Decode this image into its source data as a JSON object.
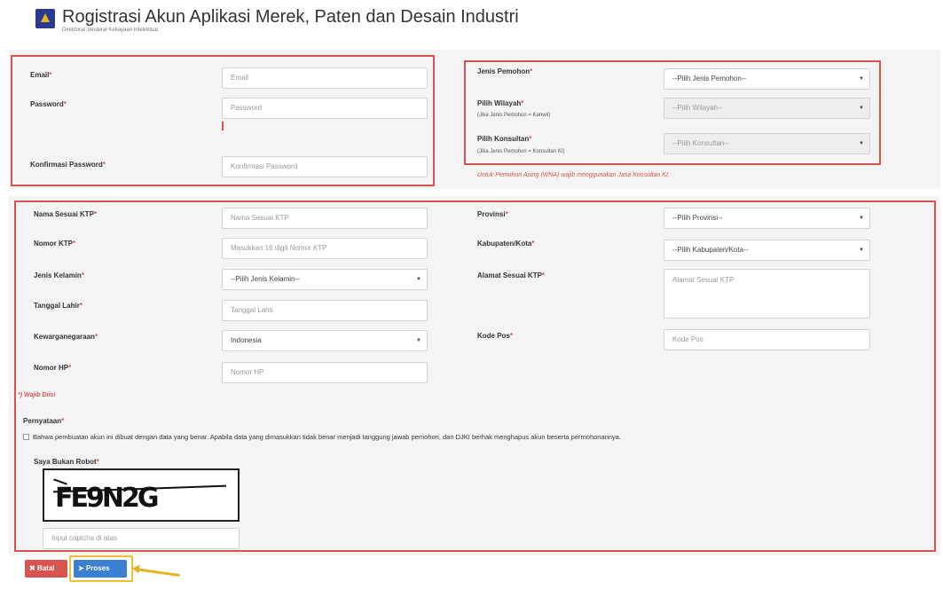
{
  "header": {
    "title": "Rogistrasi Akun Aplikasi Merek, Paten dan Desain Industri",
    "subtitle": "Direktorat Jenderal Kekayaan Intelektual"
  },
  "required_mark": "*",
  "account": {
    "email_label": "Email",
    "email_placeholder": "Email",
    "password_label": "Password",
    "password_placeholder": "Password",
    "confirm_label": "Konfirmasi Password",
    "confirm_placeholder": "Konfirmasi Password"
  },
  "applicant": {
    "jenis_label": "Jenis Pemohon",
    "jenis_value": "--Pilih Jenis Pemohon--",
    "wilayah_label": "Pilih Wilayah",
    "wilayah_hint": "(Jika Jenis Pemohon = Kanwil)",
    "wilayah_value": "--Pilih Wilayah--",
    "konsultan_label": "Pilih Konsultan",
    "konsultan_hint": "(Jika Jenis Pemohon = Konsultan KI)",
    "konsultan_value": "--Pilih Konsultan--",
    "foreign_note": "Untuk Pemohon Asing (WNA) wajib menggunakan Jasa Konsultan KI."
  },
  "personal": {
    "nama_label": "Nama Sesuai KTP",
    "nama_placeholder": "Nama Sesuai KTP",
    "ktp_label": "Nomor KTP",
    "ktp_placeholder": "Masukkan 16 digit Nomor KTP",
    "gender_label": "Jenis Kelamin",
    "gender_value": "--Pilih Jenis Kelamin--",
    "dob_label": "Tanggal Lahir",
    "dob_placeholder": "Tanggal Lahir",
    "citizenship_label": "Kewarganegaraan",
    "citizenship_value": "Indonesia",
    "hp_label": "Nomor HP",
    "hp_placeholder": "Nomor HP",
    "provinsi_label": "Provinsi",
    "provinsi_value": "--Pilih Provinsi--",
    "kabupaten_label": "Kabupaten/Kota",
    "kabupaten_value": "--Pilih Kabupaten/Kota--",
    "alamat_label": "Alamat Sesuai KTP",
    "alamat_placeholder": "Alamat Sesuai KTP",
    "kodepos_label": "Kode Pos",
    "kodepos_placeholder": "Kode Pos",
    "required_note": "*) Wajib Diisi"
  },
  "statement": {
    "label": "Pernyataan",
    "text": "Bahwa pembuatan akun ini dibuat dengan data yang benar. Apabila data yang dimasukkan tidak benar menjadi tanggung jawab pemohon, dan DJKI berhak menghapus akun beserta permohonannya."
  },
  "captcha": {
    "label": "Saya Bukan Robot",
    "text": "FE9N2G",
    "placeholder": "Input captcha di atas"
  },
  "actions": {
    "batal_label": "Batal",
    "batal_icon": "✖",
    "proses_label": "Proses",
    "proses_icon": "➤"
  },
  "colors": {
    "highlight": "#d9534f",
    "batal": "#d9534f",
    "proses": "#3a7fd0",
    "annotation": "#f0c030"
  }
}
